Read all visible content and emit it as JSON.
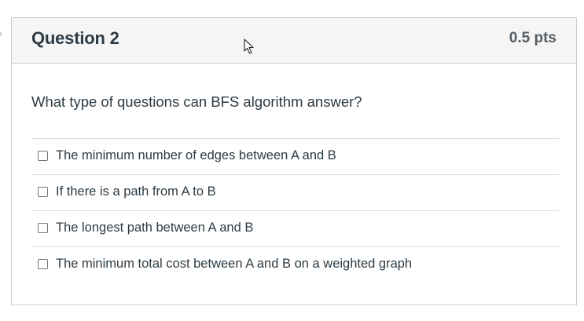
{
  "question": {
    "title": "Question 2",
    "points": "0.5 pts",
    "text": "What type of questions can BFS algorithm answer?"
  },
  "answers": [
    {
      "label": "The minimum number of edges between A and B",
      "checked": false
    },
    {
      "label": "If there is a path from A to B",
      "checked": false
    },
    {
      "label": "The longest path between A and B",
      "checked": false
    },
    {
      "label": "The minimum total cost between A and B on a weighted graph",
      "checked": false
    }
  ],
  "icons": {
    "cursor": "mouse-pointer-icon"
  },
  "colors": {
    "header_bg": "#f5f5f5",
    "border": "#c7cdd1",
    "text": "#2d3b45"
  }
}
